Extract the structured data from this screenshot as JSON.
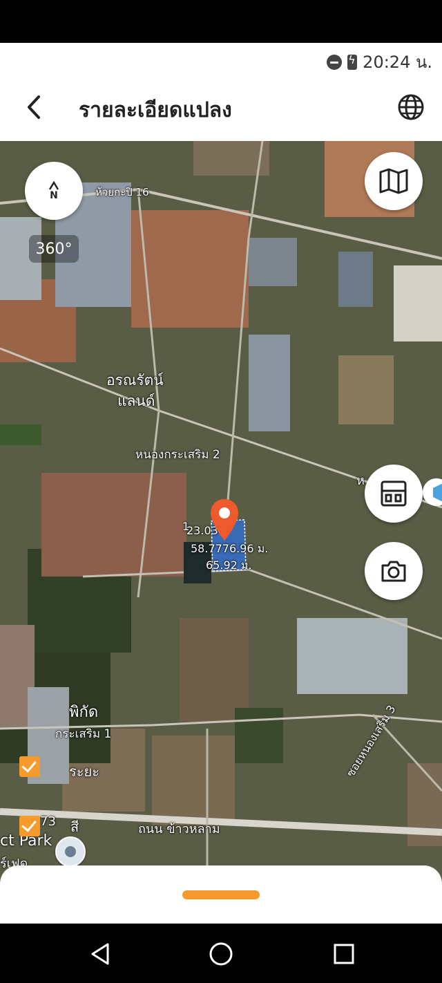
{
  "status_bar": {
    "time": "20:24 น."
  },
  "header": {
    "title": "รายละเอียดแปลง",
    "back_icon": "back-arrow-icon",
    "globe_icon": "globe-icon"
  },
  "map": {
    "compass_label": "N",
    "view_360_label": "360°",
    "map_type_icon": "map-icon",
    "floorplan_icon": "floorplan-icon",
    "camera_icon": "camera-icon",
    "place_labels": {
      "huaykapi": "ห้วยกะปิ 16",
      "aronrat_1": "อรณรัตน์",
      "aronrat_2": "แลนด์",
      "nongkrasoem2": "หนองกระเสริม 2",
      "partial_h": "ห",
      "pikad": "พิกัด",
      "krasoem1": "กระเสริม 1",
      "raya": "ระยะ",
      "road_num": "73",
      "road_si": "สี",
      "soi_nongsoem3": "ซอยหนองเสริม 3",
      "thanon_khaolam": "ถนน ข้าวหลาม",
      "ct_park": "ct Park",
      "ri_fet": "ร์เฟด"
    },
    "measurements": {
      "top": "23.03",
      "top_prefix": "1",
      "left_right": "58.7776.96 ม.",
      "bottom": "65.92 ม."
    },
    "colors": {
      "accent": "#f59a2c",
      "pin": "#ee5a2c",
      "parcel": "#2f6fdc"
    }
  },
  "navigation": {
    "back_icon": "triangle-back-icon",
    "home_icon": "circle-home-icon",
    "recents_icon": "square-recents-icon"
  }
}
